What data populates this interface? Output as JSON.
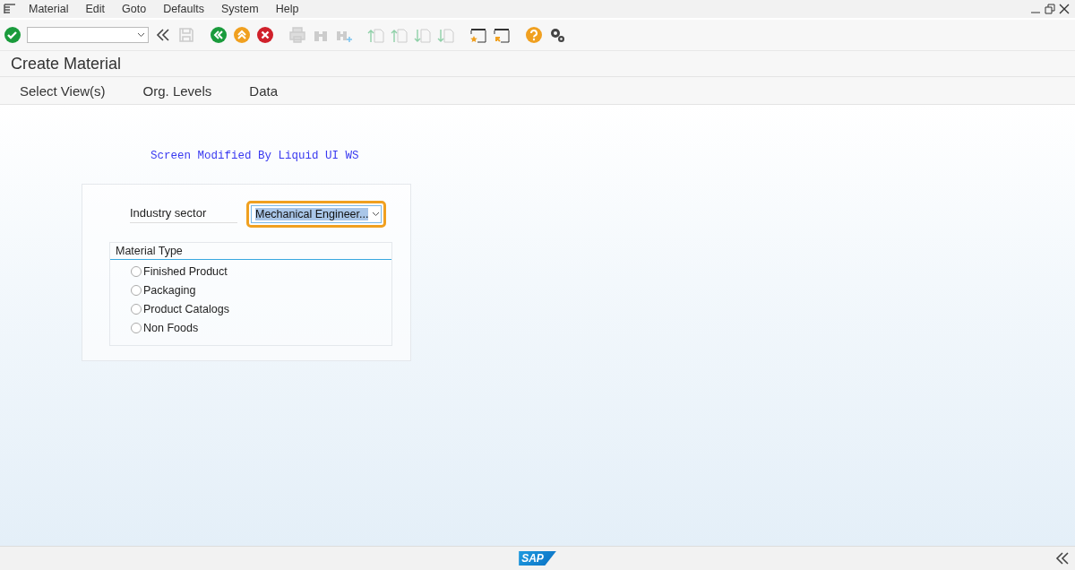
{
  "menu": [
    "Material",
    "Edit",
    "Goto",
    "Defaults",
    "System",
    "Help"
  ],
  "title": "Create Material",
  "app_toolbar": [
    "Select View(s)",
    "Org. Levels",
    "Data"
  ],
  "banner": "Screen Modified By Liquid UI WS",
  "industry_sector": {
    "label": "Industry sector",
    "value": "Mechanical Engineer...",
    "focused": true
  },
  "material_type": {
    "title": "Material Type",
    "options": [
      {
        "label": "Finished Product",
        "selected": false
      },
      {
        "label": "Packaging",
        "selected": false
      },
      {
        "label": "Product Catalogs",
        "selected": false
      },
      {
        "label": "Non Foods",
        "selected": false
      }
    ]
  },
  "footer": {
    "logo": "SAP"
  }
}
